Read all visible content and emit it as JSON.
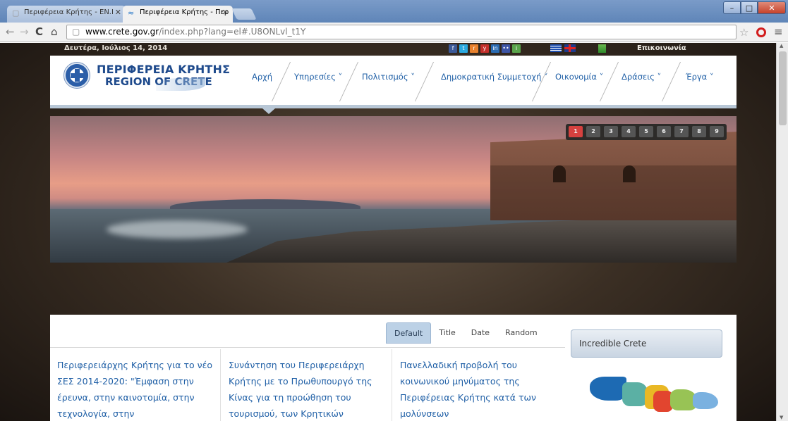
{
  "browser": {
    "tabs": [
      {
        "title": "Περιφέρεια Κρήτης - EN.I",
        "active": false
      },
      {
        "title": "Περιφέρεια Κρήτης - Περ",
        "active": true
      }
    ],
    "url_host": "www.crete.gov.gr",
    "url_path": "/index.php?lang=el#.U8ONLvl_t1Y",
    "icons": [
      "back-arrow-icon",
      "forward-arrow-icon",
      "reload-icon",
      "home-icon",
      "page-icon",
      "bookmark-star-icon",
      "opera-icon",
      "menu-icon"
    ]
  },
  "topbar": {
    "date": "Δευτέρα, Ιούλιος 14, 2014",
    "contact": "Επικοινωνία",
    "social": [
      {
        "icon": "facebook-icon",
        "color": "#3b5998",
        "glyph": "f"
      },
      {
        "icon": "twitter-icon",
        "color": "#2aa9e0",
        "glyph": "t"
      },
      {
        "icon": "rss-icon",
        "color": "#e8812d",
        "glyph": "r"
      },
      {
        "icon": "youtube-icon",
        "color": "#c4302b",
        "glyph": "y"
      },
      {
        "icon": "linkedin-icon",
        "color": "#2b6cb3",
        "glyph": "in"
      },
      {
        "icon": "flickr-icon",
        "color": "#3d55a5",
        "glyph": "••"
      },
      {
        "icon": "instagram-icon",
        "color": "#5aa54b",
        "glyph": "i"
      }
    ]
  },
  "header": {
    "title": "ΠΕΡΙΦΕΡΕΙΑ ΚΡΗΤΗΣ",
    "subtitle": "REGION OF CRETE",
    "nav": [
      {
        "label": "Αρχή"
      },
      {
        "label": "Υπηρεσίες ˅"
      },
      {
        "label": "Πολιτισμός ˅"
      },
      {
        "label": "Δημοκρατική Συμμετοχή ˅"
      },
      {
        "label": "Οικονομία ˅"
      },
      {
        "label": "Δράσεις ˅"
      },
      {
        "label": "Έργα ˅"
      }
    ]
  },
  "slider": {
    "pages": [
      "1",
      "2",
      "3",
      "4",
      "5",
      "6",
      "7",
      "8",
      "9"
    ],
    "current": "1"
  },
  "content": {
    "sort_tabs": [
      "Default",
      "Title",
      "Date",
      "Random"
    ],
    "active_sort": "Default",
    "news": [
      "Περιφερειάρχης Κρήτης για το νέο ΣΕΣ 2014-2020: \"Έμφαση στην έρευνα, στην καινοτομία, στην τεχνολογία, στην",
      "Συνάντηση του Περιφερειάρχη Κρήτης με το Πρωθυπουργό της Κίνας για τη προώθηση του τουρισμού, των Κρητικών",
      "Πανελλαδική προβολή του κοινωνικού μηνύματος της Περιφέρειας Κρήτης κατά των μολύνσεων"
    ],
    "sidebox_title": "Incredible Crete"
  },
  "colors": {
    "link": "#1f5fa6",
    "accent_red": "#d6413f",
    "header_bar": "#b8c7d6"
  }
}
